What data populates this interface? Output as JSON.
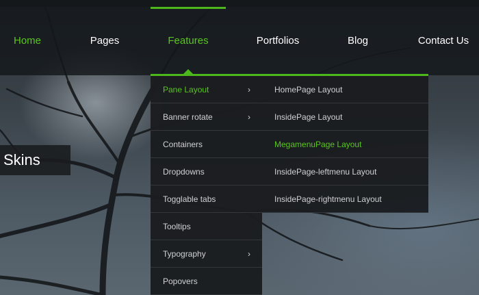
{
  "nav": {
    "items": [
      {
        "label": "Home",
        "state": "green"
      },
      {
        "label": "Pages",
        "state": "normal"
      },
      {
        "label": "Features",
        "state": "active"
      },
      {
        "label": "Portfolios",
        "state": "normal"
      },
      {
        "label": "Blog",
        "state": "normal"
      },
      {
        "label": "Contact Us",
        "state": "normal"
      }
    ]
  },
  "banner": {
    "caption": "l Skins"
  },
  "features_menu": {
    "items": [
      {
        "label": "Pane Layout",
        "has_submenu": true,
        "highlighted": true
      },
      {
        "label": "Banner rotate",
        "has_submenu": true,
        "highlighted": false
      },
      {
        "label": "Containers",
        "has_submenu": false,
        "highlighted": false
      },
      {
        "label": "Dropdowns",
        "has_submenu": false,
        "highlighted": false
      },
      {
        "label": "Togglable tabs",
        "has_submenu": false,
        "highlighted": false
      },
      {
        "label": "Tooltips",
        "has_submenu": false,
        "highlighted": false
      },
      {
        "label": "Typography",
        "has_submenu": true,
        "highlighted": false
      },
      {
        "label": "Popovers",
        "has_submenu": false,
        "highlighted": false
      }
    ],
    "chevron_glyph": "›"
  },
  "pane_layout_submenu": {
    "items": [
      {
        "label": "HomePage Layout",
        "highlighted": false
      },
      {
        "label": "InsidePage Layout",
        "highlighted": false
      },
      {
        "label": "MegamenuPage Layout",
        "highlighted": true
      },
      {
        "label": "InsidePage-leftmenu Layout",
        "highlighted": false
      },
      {
        "label": "InsidePage-rightmenu Layout",
        "highlighted": false
      }
    ]
  },
  "colors": {
    "accent_green": "#4cb81c",
    "text_green": "#59c61e",
    "nav_text": "#ffffff",
    "menu_text": "#cfd2d5",
    "menu_bg": "#1a1c1f"
  }
}
